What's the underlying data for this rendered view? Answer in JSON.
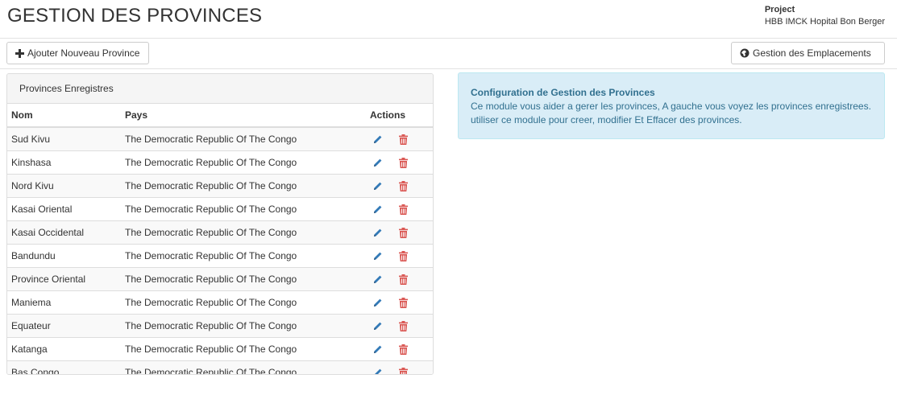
{
  "header": {
    "title": "GESTION DES PROVINCES",
    "project_label": "Project",
    "project_name": "HBB IMCK Hopital Bon Berger"
  },
  "toolbar": {
    "add_label": "Ajouter Nouveau Province",
    "locations_label": "Gestion des Emplacements"
  },
  "panel": {
    "heading": "Provinces Enregistres",
    "columns": {
      "name": "Nom",
      "country": "Pays",
      "actions": "Actions"
    },
    "rows": [
      {
        "name": "Sud Kivu",
        "country": "The Democratic Republic Of The Congo"
      },
      {
        "name": "Kinshasa",
        "country": "The Democratic Republic Of The Congo"
      },
      {
        "name": "Nord Kivu",
        "country": "The Democratic Republic Of The Congo"
      },
      {
        "name": "Kasai Oriental",
        "country": "The Democratic Republic Of The Congo"
      },
      {
        "name": "Kasai Occidental",
        "country": "The Democratic Republic Of The Congo"
      },
      {
        "name": "Bandundu",
        "country": "The Democratic Republic Of The Congo"
      },
      {
        "name": "Province Oriental",
        "country": "The Democratic Republic Of The Congo"
      },
      {
        "name": "Maniema",
        "country": "The Democratic Republic Of The Congo"
      },
      {
        "name": "Equateur",
        "country": "The Democratic Republic Of The Congo"
      },
      {
        "name": "Katanga",
        "country": "The Democratic Republic Of The Congo"
      },
      {
        "name": "Bas Congo",
        "country": "The Democratic Republic Of The Congo"
      }
    ]
  },
  "info": {
    "title": "Configuration de Gestion des Provinces",
    "body": "Ce module vous aider a gerer les provinces, A gauche vous voyez les provinces enregistrees. utiliser ce module pour creer, modifier Et Effacer des provinces."
  },
  "icons": {
    "add": "plus-icon",
    "locations": "globe-icon",
    "edit": "pencil-icon",
    "delete": "trash-icon"
  },
  "colors": {
    "edit_icon": "#337ab7",
    "delete_icon": "#d9534f",
    "info_bg": "#d9edf7",
    "info_text": "#31708f"
  }
}
